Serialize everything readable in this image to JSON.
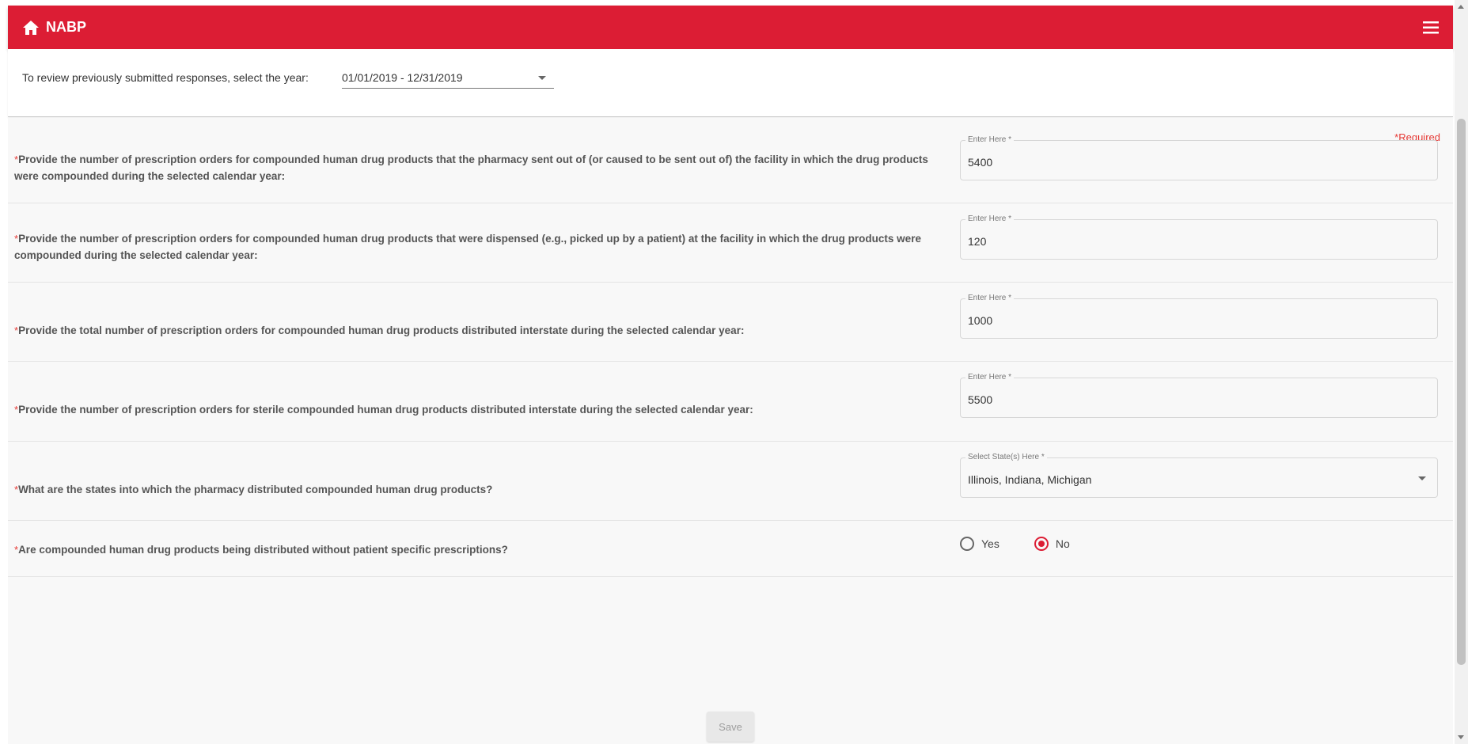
{
  "header": {
    "brand": "NABP",
    "accent_color": "#dc1d34",
    "home_icon": "home-icon",
    "menu_icon": "hamburger-menu-icon"
  },
  "year_filter": {
    "label": "To review previously submitted responses, select the year:",
    "selected": "01/01/2019 - 12/31/2019"
  },
  "form": {
    "required_note": "*Required",
    "questions": [
      {
        "star": "*",
        "text": "Provide the number of prescription orders for compounded human drug products that the pharmacy sent out of (or caused to be sent out of) the facility in which the drug products were compounded during the selected calendar year:",
        "field_label": "Enter Here *",
        "value": "5400"
      },
      {
        "star": "*",
        "text": "Provide the number of prescription orders for compounded human drug products that were dispensed (e.g., picked up by a patient) at the facility in which the drug products were compounded during the selected calendar year:",
        "field_label": "Enter Here *",
        "value": "120"
      },
      {
        "star": "*",
        "text": "Provide the total number of prescription orders for compounded human drug products distributed interstate during the selected calendar year:",
        "field_label": "Enter Here *",
        "value": "1000"
      },
      {
        "star": "*",
        "text": "Provide the number of prescription orders for sterile compounded human drug products distributed interstate during the selected calendar year:",
        "field_label": "Enter Here *",
        "value": "5500"
      },
      {
        "star": "*",
        "text": "What are the states into which the pharmacy distributed compounded human drug products?",
        "field_label": "Select State(s) Here *",
        "value": "Illinois, Indiana, Michigan"
      },
      {
        "star": "*",
        "text": "Are compounded human drug products being distributed without patient specific prescriptions?",
        "options": [
          "Yes",
          "No"
        ],
        "selected": "No"
      }
    ],
    "save_label": "Save"
  }
}
